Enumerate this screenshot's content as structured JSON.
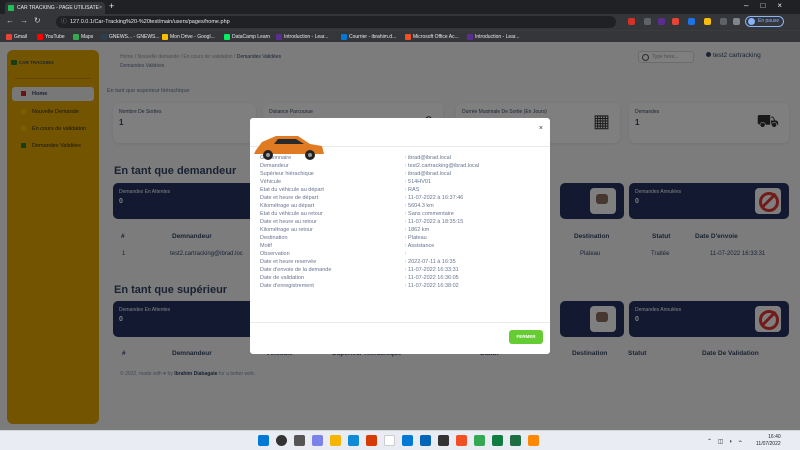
{
  "browser": {
    "tab_title": "CAR TRACKING - PAGE UTILISATE",
    "url": "127.0.0.1/Car-Tracking%20-%20test/main/users/pages/home.php",
    "profile_label": "En pause",
    "bookmarks": [
      "Gmail",
      "YouTube",
      "Maps",
      "GNEWS... - GNEWS...",
      "Mon Drive - Googl...",
      "DataCamp Learn",
      "Introduction - Lear...",
      "Courrier - ibrahim.d...",
      "Microsoft Office Ac...",
      "Introduction - Lear..."
    ]
  },
  "sidebar": {
    "brand": "CAR TRACKING",
    "items": [
      {
        "label": "Home",
        "color": "#d12929"
      },
      {
        "label": "Nouvelle Demande",
        "color": "#e6a800"
      },
      {
        "label": "En cours de validation",
        "color": "#e6a800"
      },
      {
        "label": "Demandes Validées",
        "color": "#2e7d32"
      }
    ]
  },
  "header": {
    "breadcrumb_prefix": "Home / Nouvelle demande / En cours de validation / ",
    "breadcrumb_current": "Demandes Validées",
    "subtitle": "Demandes Validées",
    "search_placeholder": "Type here...",
    "user": "test2 cartracking"
  },
  "intro": "En tant que superieur hiérachique",
  "stats": [
    {
      "label": "Nombre De Sorties",
      "value": "1"
    },
    {
      "label": "Distance Parcourue",
      "value": ""
    },
    {
      "label": "Durrée Maximale De Sortie (En Jours)",
      "value": ""
    },
    {
      "label": "Demandes",
      "value": "1"
    }
  ],
  "demandeur": {
    "title": "En tant que demandeur",
    "cards": [
      {
        "label": "Demandes En Attentes",
        "value": "0"
      },
      {
        "label": "Demandes Annulées",
        "value": "0"
      }
    ],
    "table_headers": [
      "#",
      "Demnandeur",
      "Destination",
      "Statut",
      "Date D'envoie"
    ],
    "rows": [
      [
        "1",
        "test2.cartracking@ibrad.loc",
        "Plateau",
        "Traitée",
        "11-07-2022 16:33:31"
      ]
    ]
  },
  "superieur": {
    "title": "En tant que supérieur",
    "cards": [
      {
        "label": "Demandes En Attentes",
        "value": "0"
      },
      {
        "label": "Demandes Annulées",
        "value": "0"
      }
    ],
    "table_headers": [
      "#",
      "Demnandeur",
      "Véhicule",
      "Supérieur Hiérachique",
      "Statut",
      "Destination",
      "Statut",
      "Date De Validation"
    ]
  },
  "footer": {
    "text": "© 2022, made with ♥ by ",
    "author": "Ibrahim Diabagate",
    "suffix": " for a better web."
  },
  "modal": {
    "close": "×",
    "button": "FERMER",
    "fields": [
      {
        "k": "Gestionnaire",
        "v": ": ibrad@ibrad.local"
      },
      {
        "k": "Demandeur",
        "v": ": test2.cartracking@ibrad.local"
      },
      {
        "k": "Supérieur hiérachique",
        "v": ": ibrad@ibrad.local"
      },
      {
        "k": "Véhicule",
        "v": ": 514HV01"
      },
      {
        "k": "Etat du véhicule au départ",
        "v": ": RAS"
      },
      {
        "k": "Date et heure de départ",
        "v": ": 11-07-2022 à 16:37:46"
      },
      {
        "k": "Kilométrage au départ",
        "v": ": 5604.3 km"
      },
      {
        "k": "Etat du véhicule au retour",
        "v": ": Sans commentaire"
      },
      {
        "k": "Date et heure au retour",
        "v": ": 11-07-2022 à 18:35:15"
      },
      {
        "k": "Kilométrage au retour",
        "v": ": 1862 km"
      },
      {
        "k": "Destination",
        "v": ": Plateau"
      },
      {
        "k": "Motif",
        "v": ": Assistance"
      },
      {
        "k": "Observation",
        "v": ":"
      },
      {
        "k": "Date et heure reservée",
        "v": ": 2022-07-11 à 16:35"
      },
      {
        "k": "Date d'envoie de la demande",
        "v": ": 11-07-2022 16:33:31"
      },
      {
        "k": "Date de validation",
        "v": ": 11-07-2022 16:36:05"
      },
      {
        "k": "Date d'enregistrement",
        "v": ": 11-07-2022 16:38:02"
      }
    ]
  },
  "taskbar": {
    "time": "16:40",
    "date": "11/07/2022"
  }
}
